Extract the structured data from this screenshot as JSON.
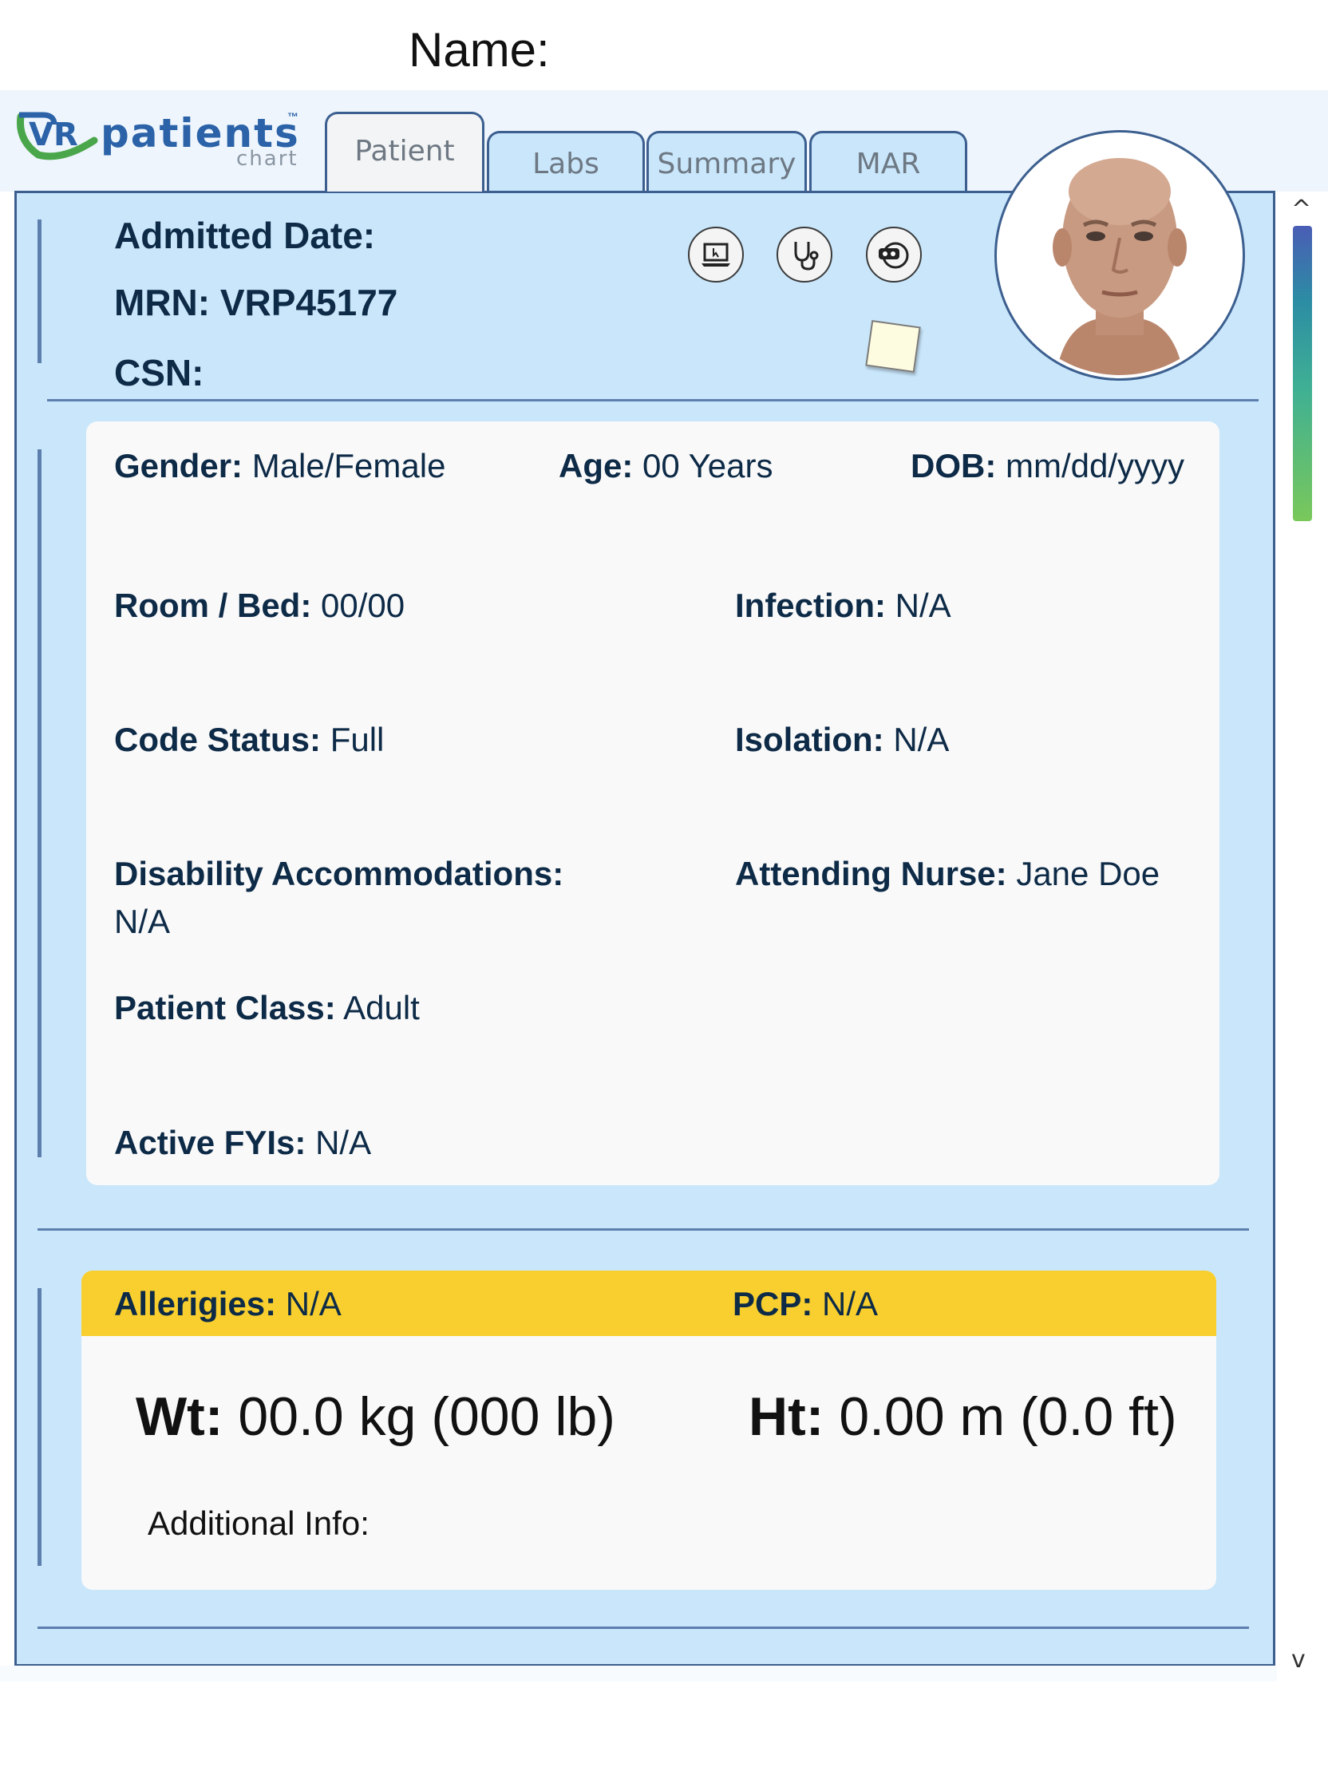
{
  "worksheet": {
    "name_label": "Name:"
  },
  "logo": {
    "mark": "VR",
    "word": "patients",
    "tm": "™",
    "sub": "chart"
  },
  "tabs": [
    {
      "label": "Patient",
      "active": true
    },
    {
      "label": "Labs",
      "active": false
    },
    {
      "label": "Summary",
      "active": false
    },
    {
      "label": "MAR",
      "active": false
    }
  ],
  "header": {
    "admitted_label": "Admitted Date:",
    "admitted_value": "",
    "mrn_label": "MRN:",
    "mrn_value": "VRP45177",
    "csn_label": "CSN:",
    "csn_value": ""
  },
  "icons": [
    "laptop-icon",
    "stethoscope-icon",
    "vr-headset-icon",
    "sticky-note-icon"
  ],
  "demographics": {
    "gender": {
      "label": "Gender:",
      "value": "Male/Female"
    },
    "age": {
      "label": "Age:",
      "value": "00 Years"
    },
    "dob": {
      "label": "DOB:",
      "value": "mm/dd/yyyy"
    },
    "room_bed": {
      "label": "Room / Bed:",
      "value": "00/00"
    },
    "infection": {
      "label": "Infection:",
      "value": "N/A"
    },
    "code_status": {
      "label": "Code Status:",
      "value": "Full"
    },
    "isolation": {
      "label": "Isolation:",
      "value": "N/A"
    },
    "disability": {
      "label": "Disability Accommodations:",
      "value": "N/A"
    },
    "attending_nurse": {
      "label": "Attending Nurse:",
      "value": "Jane Doe"
    },
    "patient_class": {
      "label": "Patient Class:",
      "value": "Adult"
    },
    "active_fyis": {
      "label": "Active FYIs:",
      "value": "N/A"
    }
  },
  "clinical": {
    "allergies": {
      "label": "Allerigies:",
      "value": "N/A"
    },
    "pcp": {
      "label": "PCP:",
      "value": "N/A"
    },
    "weight": {
      "label": "Wt:",
      "value": "00.0 kg (000 lb)"
    },
    "height": {
      "label": "Ht:",
      "value": "0.00 m (0.0 ft)"
    },
    "additional_info_label": "Additional Info:"
  },
  "scrollbar": {
    "up": "^",
    "down": "v"
  },
  "colors": {
    "panel": "#c9e6fb",
    "border": "#3c5f8f",
    "card": "#f9f9f9",
    "allergy_band": "#f8cf2e",
    "text": "#0d2a47"
  }
}
